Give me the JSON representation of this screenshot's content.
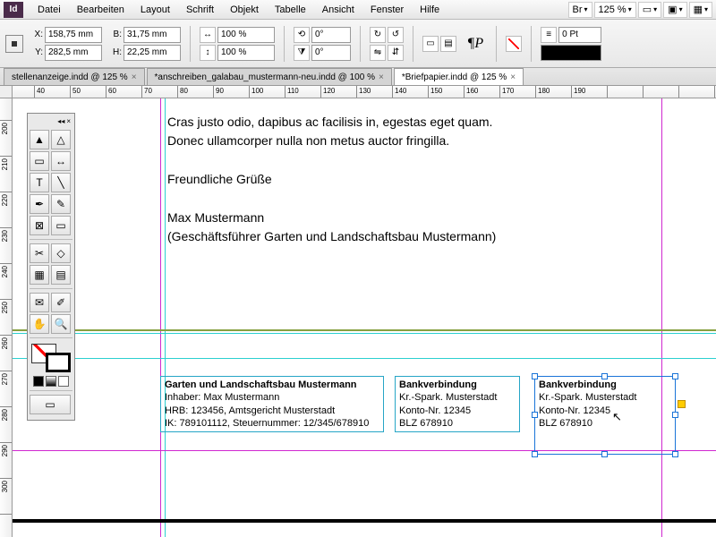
{
  "menu": {
    "items": [
      "Datei",
      "Bearbeiten",
      "Layout",
      "Schrift",
      "Objekt",
      "Tabelle",
      "Ansicht",
      "Fenster",
      "Hilfe"
    ],
    "zoom": "125 %",
    "br": "Br"
  },
  "toolbar": {
    "x": "158,75 mm",
    "y": "282,5 mm",
    "b": "31,75 mm",
    "h": "22,25 mm",
    "scale1": "100 %",
    "scale2": "100 %",
    "rot1": "0°",
    "rot2": "0°",
    "stroke": "0 Pt"
  },
  "tabs": [
    {
      "label": "stellenanzeige.indd @ 125 %",
      "active": false
    },
    {
      "label": "*anschreiben_galabau_mustermann-neu.indd @ 100 %",
      "active": false
    },
    {
      "label": "*Briefpapier.indd @ 125 %",
      "active": true
    }
  ],
  "hruler": [
    "40",
    "50",
    "60",
    "70",
    "80",
    "90",
    "100",
    "110",
    "120",
    "130",
    "140",
    "150",
    "160",
    "170",
    "180",
    "190"
  ],
  "vruler": [
    "200",
    "210",
    "220",
    "230",
    "240",
    "250",
    "260",
    "270",
    "280",
    "290",
    "300"
  ],
  "body": {
    "line1": "Cras justo odio, dapibus ac facilisis in, egestas eget quam.",
    "line2": "Donec ullamcorper nulla non metus auctor fringilla.",
    "greet": "Freundliche Grüße",
    "name": "Max Mustermann",
    "role": "(Geschäftsführer Garten und Landschaftsbau Mustermann)"
  },
  "footer1": {
    "t": "Garten und Landschaftsbau Mustermann",
    "l1": "Inhaber: Max Mustermann",
    "l2": "HRB: 123456, Amtsgericht Musterstadt",
    "l3": "IK: 789101112, Steuernummer: 12/345/678910"
  },
  "footer2": {
    "t": "Bankverbindung",
    "l1": "Kr.-Spark. Musterstadt",
    "l2": "Konto-Nr. 12345",
    "l3": "BLZ 678910"
  },
  "footer3": {
    "t": "Bankverbindung",
    "l1": "Kr.-Spark. Musterstadt",
    "l2": "Konto-Nr. 12345",
    "l3": "BLZ 678910"
  }
}
